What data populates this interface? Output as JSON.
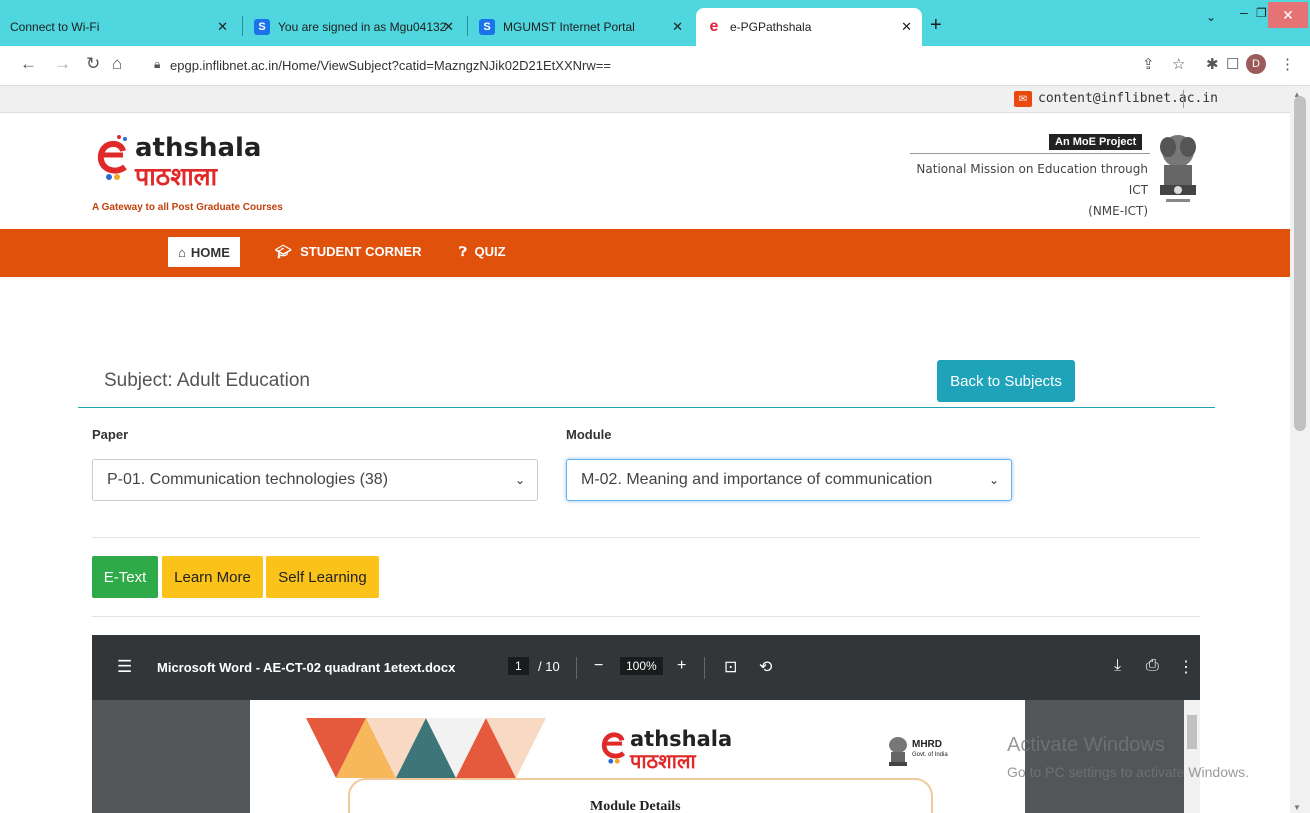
{
  "browser": {
    "tabs": [
      {
        "title": "Connect to Wi-Fi"
      },
      {
        "title": "You are signed in as Mgu04132",
        "favicon": "S"
      },
      {
        "title": "MGUMST Internet Portal",
        "favicon": "S"
      },
      {
        "title": "e-PGPathshala",
        "favicon": "e"
      }
    ],
    "url": "epgp.inflibnet.ac.in/Home/ViewSubject?catid=MazngzNJik02D21EtXXNrw==",
    "profile_initial": "D"
  },
  "page": {
    "contact_email": "content@inflibnet.ac.in",
    "logo_en": "athshala",
    "logo_hi": "पाठशाला",
    "tagline": "A Gateway to all Post Graduate Courses",
    "moe_badge": "An MoE Project",
    "mission_line1": "National Mission on Education through ICT",
    "mission_line2": "(NME-ICT)",
    "nav": {
      "home": "HOME",
      "student_corner": "STUDENT CORNER",
      "quiz": "QUIZ"
    },
    "subject_title": "Subject: Adult Education",
    "back_button": "Back to Subjects",
    "paper_label": "Paper",
    "paper_value": "P-01. Communication technologies (38)",
    "module_label": "Module",
    "module_value": "M-02. Meaning and importance of communication",
    "buttons": {
      "etext": "E-Text",
      "learn_more": "Learn More",
      "self_learning": "Self Learning"
    },
    "colors": {
      "nav_bar": "#e0510c",
      "teal": "#1fa3bb",
      "green": "#2eaa49",
      "yellow": "#fbc21a"
    }
  },
  "pdf_viewer": {
    "title": "Microsoft Word - AE-CT-02 quadrant 1etext.docx",
    "current_page": "1",
    "total_pages": "/ 10",
    "zoom": "100%",
    "doc_logo_en": "athshala",
    "doc_logo_hi": "पाठशाला",
    "doc_mhrd": "MHRD",
    "doc_mhrd_sub": "Govt. of India",
    "doc_heading": "Module Details"
  },
  "watermark": {
    "line1": "Activate Windows",
    "line2": "Go to PC settings to activate Windows."
  }
}
